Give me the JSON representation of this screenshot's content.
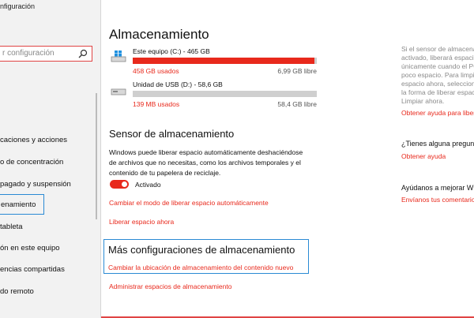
{
  "window": {
    "title_partial": "nfiguración"
  },
  "sidebar": {
    "search_placeholder": "r configuración",
    "items": [
      {
        "label": "caciones y acciones"
      },
      {
        "label": "o de concentración"
      },
      {
        "label": "pagado y suspensión"
      },
      {
        "label": "enamiento"
      },
      {
        "label": "tableta"
      },
      {
        "label": "ón en este equipo"
      },
      {
        "label": "encias compartidas"
      },
      {
        "label": "do remoto"
      }
    ]
  },
  "main": {
    "title": "Almacenamiento",
    "drives": [
      {
        "name": "Este equipo (C:) - 465 GB",
        "used": "458 GB usados",
        "free": "6,99 GB libre",
        "used_fraction": 0.985
      },
      {
        "name": "Unidad de USB (D:) - 58,6 GB",
        "used": "139 MB usados",
        "free": "58,4 GB libre",
        "used_fraction": 0.0
      }
    ],
    "sensor": {
      "heading": "Sensor de almacenamiento",
      "description": "Windows puede liberar espacio automáticamente deshaciéndose de archivos que no necesitas, como los archivos temporales y el contenido de tu papelera de reciclaje.",
      "toggle_label": "Activado",
      "link_change": "Cambiar el modo de liberar espacio automáticamente",
      "link_free_now": "Liberar espacio ahora"
    },
    "more": {
      "heading": "Más configuraciones de almacenamiento",
      "link_change_location": "Cambiar la ubicación de almacenamiento del contenido nuevo",
      "link_manage_spaces": "Administrar espacios de almacenamiento"
    }
  },
  "right": {
    "info_lines": [
      "Si el sensor de almacena",
      "activado, liberará espaci",
      "únicamente cuando el PC",
      "poco espacio. Para limpia",
      "espacio ahora, seleccion",
      "la forma de liberar espaci",
      "Limpiar ahora."
    ],
    "help_link": "Obtener ayuda para liber",
    "question_heading": "¿Tienes alguna pregunta",
    "get_help": "Obtener ayuda",
    "improve_heading": "Ayúdanos a mejorar Win",
    "feedback_link": "Envíanos tus comentario"
  },
  "colors": {
    "accent": "#e8291c",
    "focus": "#2a8ad4"
  }
}
